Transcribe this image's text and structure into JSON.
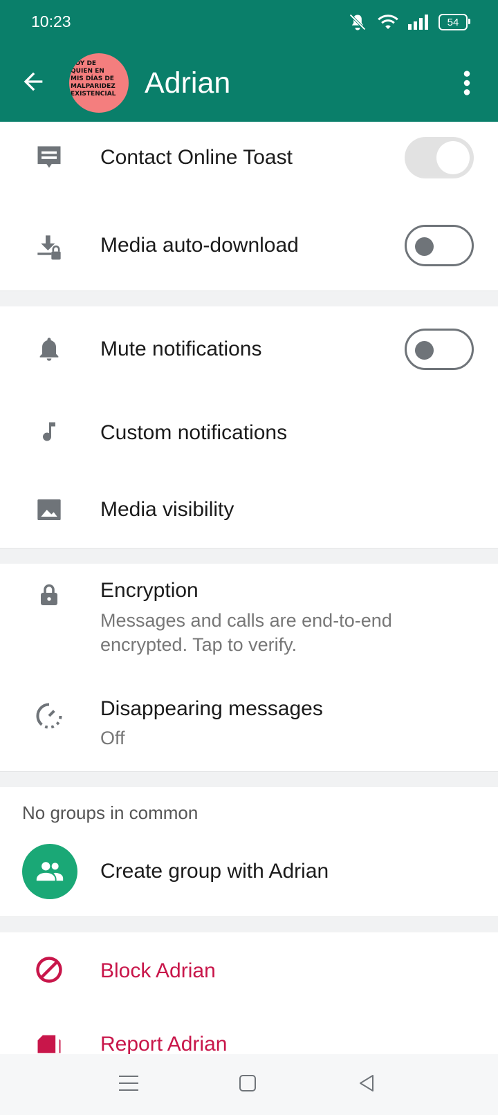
{
  "status": {
    "time": "10:23",
    "battery": "54"
  },
  "header": {
    "name": "Adrian",
    "avatar_text": "SOY DE\nQUIEN EN\nMIS DÍAS DE\nMALPARIDEZ\nEXISTENCIAL"
  },
  "settings": {
    "online_toast": {
      "label": "Contact Online Toast",
      "toggle": "on-disabled"
    },
    "auto_download": {
      "label": "Media auto-download",
      "toggle": "off"
    },
    "mute": {
      "label": "Mute notifications",
      "toggle": "off"
    },
    "custom": {
      "label": "Custom notifications"
    },
    "visibility": {
      "label": "Media visibility"
    },
    "encryption": {
      "label": "Encryption",
      "sub": "Messages and calls are end-to-end encrypted. Tap to verify."
    },
    "disappearing": {
      "label": "Disappearing messages",
      "sub": "Off"
    }
  },
  "groups": {
    "header": "No groups in common",
    "create_label": "Create group with Adrian"
  },
  "actions": {
    "block": "Block Adrian",
    "report": "Report Adrian"
  },
  "colors": {
    "appbar": "#0a7f6a",
    "accent_green": "#1aa876",
    "danger": "#c8164a"
  },
  "icons": [
    "arrow-left-icon",
    "more-vert-icon",
    "message-icon",
    "download-lock-icon",
    "bell-icon",
    "music-note-icon",
    "image-icon",
    "lock-icon",
    "timer-icon",
    "group-icon",
    "block-icon",
    "report-icon",
    "menu-icon",
    "square-icon",
    "back-triangle-icon"
  ]
}
